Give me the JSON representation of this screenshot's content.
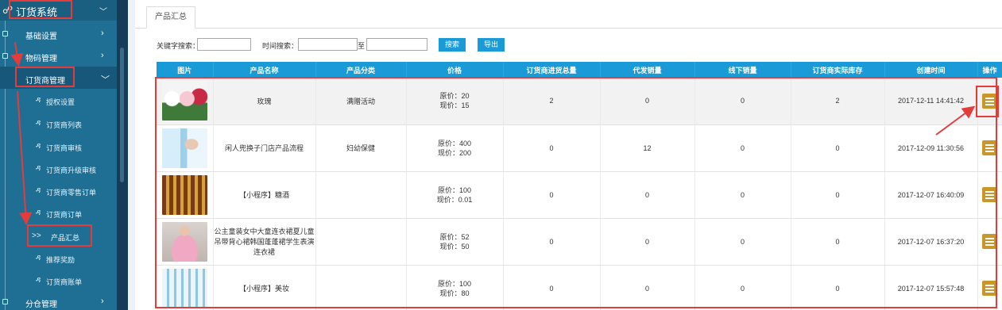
{
  "sidebar": {
    "logo_icon": "sitemap-icon",
    "title": "订货系统",
    "menu": [
      {
        "label": "基础设置"
      },
      {
        "label": "物码管理"
      },
      {
        "label": "订货商管理"
      }
    ],
    "sub_items": [
      {
        "label": "授权设置"
      },
      {
        "label": "订货商列表"
      },
      {
        "label": "订货商审核"
      },
      {
        "label": "订货商升级审核"
      },
      {
        "label": "订货商零售订单"
      },
      {
        "label": "订货商订单"
      },
      {
        "label": "产品汇总"
      },
      {
        "label": "推荐奖励"
      },
      {
        "label": "订货商账单"
      }
    ],
    "active_prefix": ">>",
    "bottom_menu": {
      "label": "分仓管理"
    }
  },
  "tab": {
    "label": "产品汇总"
  },
  "search": {
    "keyword_label": "关键字搜索：",
    "keyword_value": "",
    "time_label": "时间搜索：",
    "time_from": "",
    "time_to_label": "至",
    "time_to": "",
    "search_button": "搜索",
    "export_button": "导出"
  },
  "table": {
    "headers": [
      "图片",
      "产品名称",
      "产品分类",
      "价格",
      "订货商进货总量",
      "代发销量",
      "线下销量",
      "订货商实际库存",
      "创建时间",
      "操作"
    ],
    "rows": [
      {
        "name": "玫瑰",
        "category": "满赠活动",
        "orig": "原价：20",
        "now": "现价：15",
        "total": "2",
        "dropship": "0",
        "offline": "0",
        "stock": "2",
        "created": "2017-12-11 14:41:42"
      },
      {
        "name": "闲人兜换子门店产品流程",
        "category": "妇幼保健",
        "orig": "原价：400",
        "now": "现价：200",
        "total": "0",
        "dropship": "12",
        "offline": "0",
        "stock": "0",
        "created": "2017-12-09 11:30:56"
      },
      {
        "name": "【小程序】糖酒",
        "category": "",
        "orig": "原价：100",
        "now": "现价：0.01",
        "total": "0",
        "dropship": "0",
        "offline": "0",
        "stock": "0",
        "created": "2017-12-07 16:40:09"
      },
      {
        "name": "公主童装女中大童连衣裙夏儿童吊带背心裙韩国蓬蓬裙学生表演连衣裙",
        "category": "",
        "orig": "原价：52",
        "now": "现价：50",
        "total": "0",
        "dropship": "0",
        "offline": "0",
        "stock": "0",
        "created": "2017-12-07 16:37:20"
      },
      {
        "name": "【小程序】美妆",
        "category": "",
        "orig": "原价：100",
        "now": "现价：80",
        "total": "0",
        "dropship": "0",
        "offline": "0",
        "stock": "0",
        "created": "2017-12-07 15:57:48"
      }
    ]
  },
  "colors": {
    "sidebar_bg": "#1f6e93",
    "header_blue": "#1a9bd7",
    "annotation_red": "#e53b3b",
    "action_gold": "#c9962a"
  },
  "icons": {
    "submenu_item": "user-group-icon",
    "action": "list-icon",
    "expand": "chevron-right-icon",
    "collapse": "chevron-down-icon"
  }
}
